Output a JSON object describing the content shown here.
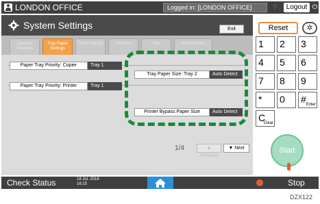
{
  "topbar": {
    "office": "LONDON OFFICE",
    "login": "Logged in: [LONDON OFFICE]",
    "help": "?",
    "logout": "Logout",
    "power": "⏻"
  },
  "header": {
    "title": "System Settings",
    "exit": "Exit"
  },
  "tabs": [
    {
      "label": "General Features",
      "active": false
    },
    {
      "label": "Tray Paper Settings",
      "active": true
    },
    {
      "label": "Timer Settings",
      "active": false
    },
    {
      "label": "Interface",
      "active": false
    },
    {
      "label": "File",
      "active": false
    },
    {
      "label": "Administrator",
      "active": false
    }
  ],
  "settings": {
    "copier": {
      "label": "Paper Tray Priority: Copier",
      "value": "Tray 1"
    },
    "printer": {
      "label": "Paper Tray Priority: Printer",
      "value": "Tray 1"
    },
    "tray2": {
      "label": "Tray Paper Size: Tray 2",
      "value": "Auto Detect"
    },
    "bypass": {
      "label": "Printer Bypass Paper Size",
      "value": "Auto Detect"
    }
  },
  "pagination": {
    "indicator": "1/4",
    "previous": "▲ Previous",
    "next": "▼ Next"
  },
  "keypad": {
    "reset": "Reset",
    "settings_icon": "✲",
    "keys": [
      {
        "main": "1",
        "sub": ""
      },
      {
        "main": "2",
        "sub": ""
      },
      {
        "main": "3",
        "sub": ""
      },
      {
        "main": "4",
        "sub": ""
      },
      {
        "main": "5",
        "sub": ""
      },
      {
        "main": "6",
        "sub": ""
      },
      {
        "main": "7",
        "sub": ""
      },
      {
        "main": "8",
        "sub": ""
      },
      {
        "main": "9",
        "sub": ""
      },
      {
        "main": "*",
        "sub": ""
      },
      {
        "main": "0",
        "sub": ""
      },
      {
        "main": "#",
        "sub": "Enter"
      },
      {
        "main": "C",
        "sub": "Clear"
      }
    ],
    "start": "Start"
  },
  "bottombar": {
    "check_status": "Check Status",
    "date": "18 Jul. 2018",
    "time": "16:15",
    "home": "⌂",
    "stop": "Stop"
  },
  "caption": "DZX122",
  "colors": {
    "accent": "#f5a04a",
    "highlight_dash": "#1a8a3a",
    "home": "#2d8fd8",
    "start": "#a6dcc4",
    "stop": "#e65c2e"
  }
}
